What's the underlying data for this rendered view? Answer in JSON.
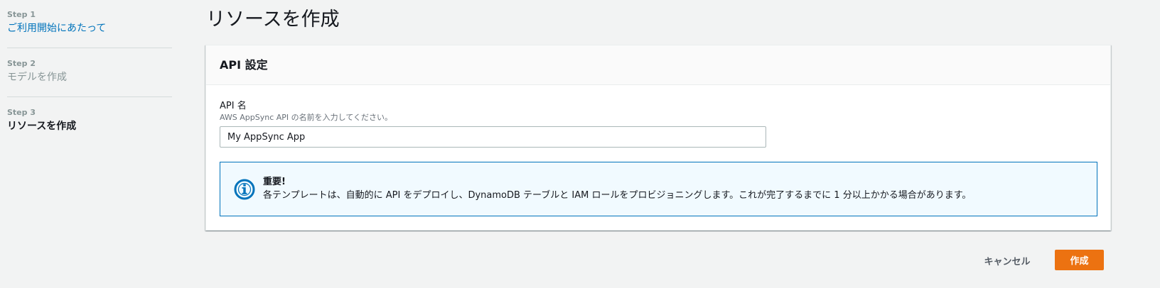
{
  "wizard": {
    "steps": [
      {
        "number": "Step 1",
        "title": "ご利用開始にあたって",
        "state": "link"
      },
      {
        "number": "Step 2",
        "title": "モデルを作成",
        "state": "disabled"
      },
      {
        "number": "Step 3",
        "title": "リソースを作成",
        "state": "current"
      }
    ]
  },
  "page": {
    "title": "リソースを作成"
  },
  "panel": {
    "heading": "API 設定",
    "field": {
      "label": "API 名",
      "description": "AWS AppSync API の名前を入力してください。",
      "value": "My AppSync App"
    },
    "alert": {
      "icon": "info-icon",
      "title": "重要!",
      "body": "各テンプレートは、自動的に API をデプロイし、DynamoDB テーブルと IAM ロールをプロビジョニングします。これが完了するまでに 1 分以上かかる場合があります。"
    }
  },
  "actions": {
    "cancel_label": "キャンセル",
    "create_label": "作成"
  },
  "colors": {
    "link": "#0073bb",
    "primary_button": "#ec7211",
    "alert_border": "#0073bb",
    "alert_background": "#f1faff",
    "info_icon": "#0073bb"
  }
}
